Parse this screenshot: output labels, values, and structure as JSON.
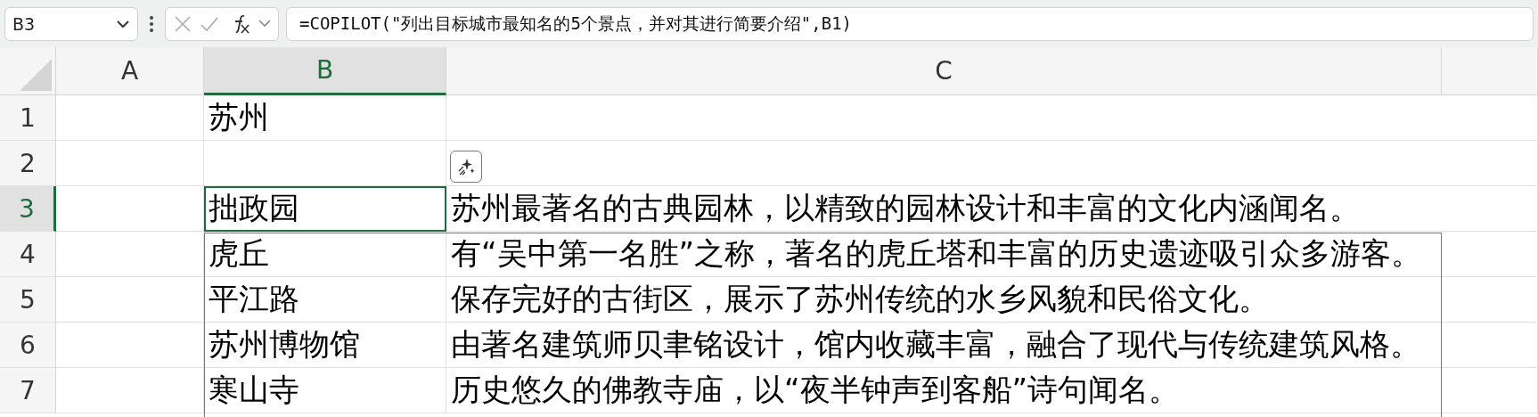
{
  "formula_bar": {
    "name_box": "B3",
    "formula": "=COPILOT(\"列出目标城市最知名的5个景点，并对其进行简要介绍\",B1)"
  },
  "columns": [
    {
      "label": "A",
      "selected": false
    },
    {
      "label": "B",
      "selected": true
    },
    {
      "label": "C",
      "selected": false
    }
  ],
  "rows": [
    {
      "number": "1",
      "selected": false,
      "B": "苏州"
    },
    {
      "number": "2",
      "selected": false
    },
    {
      "number": "3",
      "selected": true,
      "B": "拙政园",
      "C": "苏州最著名的古典园林，以精致的园林设计和丰富的文化内涵闻名。"
    },
    {
      "number": "4",
      "selected": false,
      "B": "虎丘",
      "C": "有“吴中第一名胜”之称，著名的虎丘塔和丰富的历史遗迹吸引众多游客。"
    },
    {
      "number": "5",
      "selected": false,
      "B": "平江路",
      "C": "保存完好的古街区，展示了苏州传统的水乡风貌和民俗文化。"
    },
    {
      "number": "6",
      "selected": false,
      "B": "苏州博物馆",
      "C": "由著名建筑师贝聿铭设计，馆内收藏丰富，融合了现代与传统建筑风格。"
    },
    {
      "number": "7",
      "selected": false,
      "B": "寒山寺",
      "C": "历史悠久的佛教寺庙，以“夜半钟声到客船”诗句闻名。"
    }
  ]
}
